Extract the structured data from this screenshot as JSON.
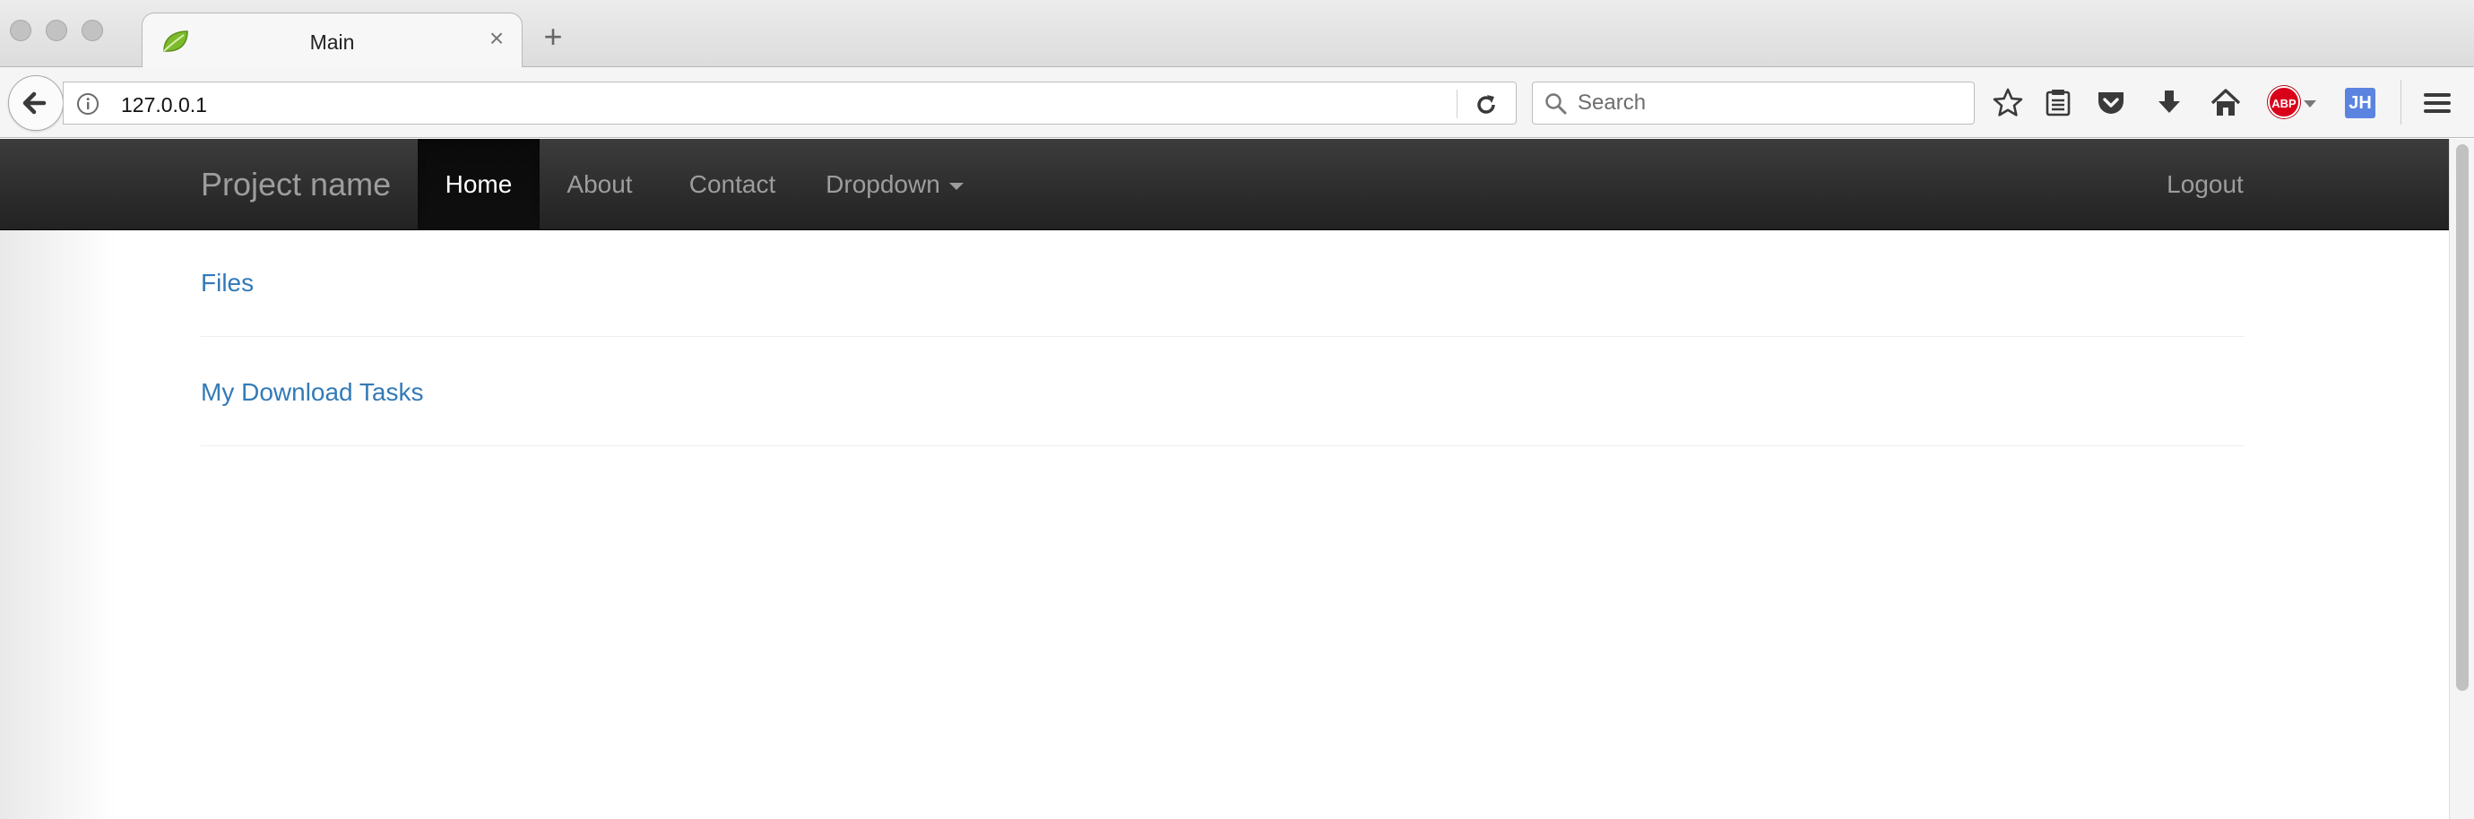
{
  "browser": {
    "tab": {
      "title": "Main",
      "favicon": "leaf-icon",
      "close_glyph": "×"
    },
    "new_tab_glyph": "+",
    "address": {
      "url": "127.0.0.1"
    },
    "search": {
      "placeholder": "Search"
    },
    "toolbar_icons": [
      "star-icon",
      "reading-list-icon",
      "pocket-icon",
      "download-icon",
      "home-icon",
      "adblock-icon",
      "jh-extension-icon",
      "hamburger-menu-icon"
    ],
    "extensions": {
      "adblock_label": "ABP",
      "jh_label": "JH"
    }
  },
  "navbar": {
    "brand": "Project name",
    "items": [
      {
        "label": "Home",
        "active": true
      },
      {
        "label": "About",
        "active": false
      },
      {
        "label": "Contact",
        "active": false
      },
      {
        "label": "Dropdown",
        "active": false
      }
    ],
    "logout": "Logout"
  },
  "main": {
    "links": [
      {
        "label": "Files"
      },
      {
        "label": "My Download Tasks"
      }
    ]
  },
  "colors": {
    "navbar_bg": "#222222",
    "nav_text": "#9d9d9d",
    "nav_active_text": "#ffffff",
    "link": "#337ab7"
  }
}
